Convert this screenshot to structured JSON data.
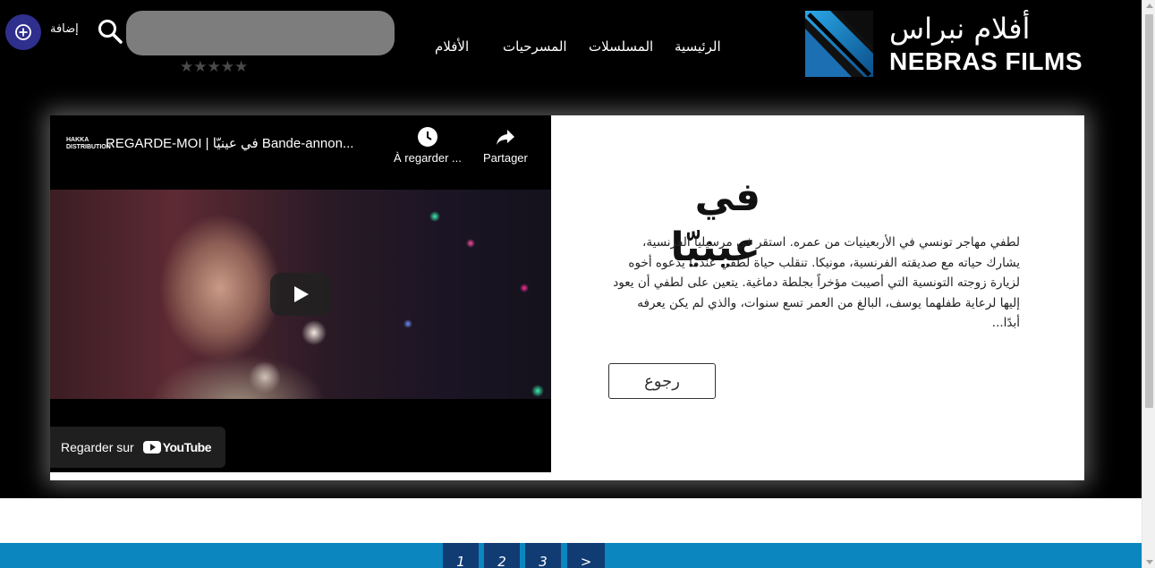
{
  "header": {
    "add_label": "إضافة",
    "search": {
      "placeholder": "",
      "value": ""
    },
    "rating_stars": "★★★★★",
    "nav": {
      "home": "الرئيسية",
      "series": "المسلسلات",
      "plays": "المسرحيات",
      "films": "الأفلام"
    },
    "logo": {
      "arabic": "أفلام نبراس",
      "english": "NEBRAS FILMS"
    }
  },
  "video": {
    "channel_logo": "HAKKA\nDISTRIBUTION",
    "title": "REGARDE-MOI | في عينيّا Bande-annon...",
    "watch_later": "À regarder ...",
    "share": "Partager",
    "watch_on": "Regarder sur",
    "youtube": "YouTube"
  },
  "film": {
    "title": "في عينيّا",
    "description": "لطفي مهاجر تونسي في الأربعينيات من عمره. استقر في مرسيليا الفرنسية، يشارك حياته مع صديقته الفرنسية، مونيكا. تنقلب حياة لطفي عندما يدعوه أخوه لزيارة زوجته التونسية التي أصيبت مؤخراً بجلطة دماغية. يتعين على لطفي أن يعود إليها لرعاية طفلهما يوسف، البالغ من العمر تسع سنوات، والذي لم يكن يعرفه أبدًا...",
    "back_label": "رجوع"
  },
  "pagination": {
    "pages": [
      "1",
      "2",
      "3"
    ],
    "next": ">"
  },
  "colors": {
    "accent_blue": "#0b86bf",
    "page_button": "#103c73",
    "add_button": "#2f2f8e"
  }
}
